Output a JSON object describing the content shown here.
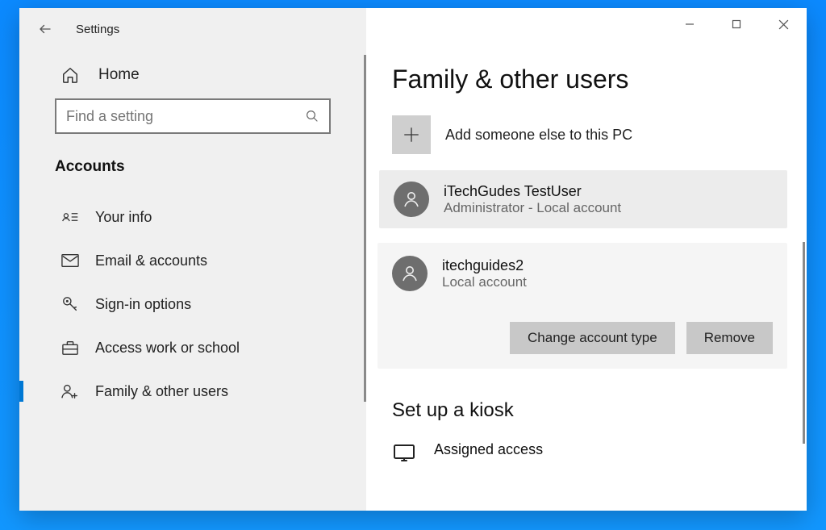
{
  "window": {
    "title": "Settings"
  },
  "sidebar": {
    "home_label": "Home",
    "search_placeholder": "Find a setting",
    "section_label": "Accounts",
    "items": [
      {
        "label": "Your info",
        "icon": "user-card-icon"
      },
      {
        "label": "Email & accounts",
        "icon": "mail-icon"
      },
      {
        "label": "Sign-in options",
        "icon": "key-icon"
      },
      {
        "label": "Access work or school",
        "icon": "briefcase-icon"
      },
      {
        "label": "Family & other users",
        "icon": "people-add-icon",
        "selected": true
      }
    ]
  },
  "content": {
    "page_title": "Family & other users",
    "add_label": "Add someone else to this PC",
    "users": [
      {
        "name": "iTechGudes TestUser",
        "role": "Administrator - Local account"
      },
      {
        "name": "itechguides2",
        "role": "Local account",
        "expanded": true
      }
    ],
    "buttons": {
      "change_type": "Change account type",
      "remove": "Remove"
    },
    "kiosk": {
      "heading": "Set up a kiosk",
      "item_title": "Assigned access"
    }
  }
}
